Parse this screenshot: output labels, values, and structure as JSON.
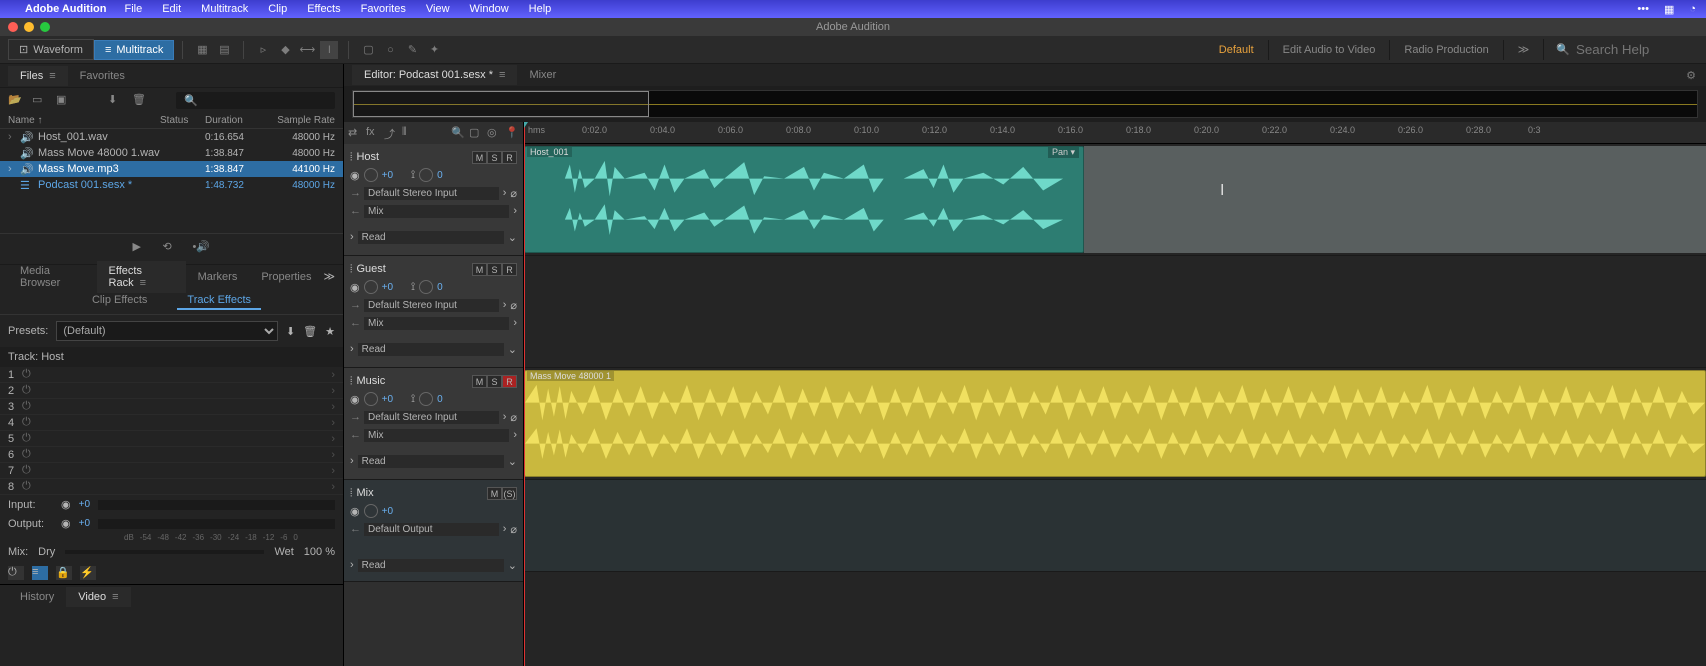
{
  "app": {
    "name": "Adobe Audition",
    "title": "Adobe Audition"
  },
  "menu": [
    "File",
    "Edit",
    "Multitrack",
    "Clip",
    "Effects",
    "Favorites",
    "View",
    "Window",
    "Help"
  ],
  "modes": {
    "waveform": "Waveform",
    "multitrack": "Multitrack"
  },
  "workspaces": {
    "default": "Default",
    "editAudio": "Edit Audio to Video",
    "radio": "Radio Production"
  },
  "search": {
    "placeholder": "Search Help"
  },
  "files": {
    "tab": "Files",
    "favorites": "Favorites",
    "cols": {
      "name": "Name ↑",
      "status": "Status",
      "duration": "Duration",
      "rate": "Sample Rate"
    },
    "rows": [
      {
        "name": "Host_001.wav",
        "dur": "0:16.654",
        "rate": "48000 Hz"
      },
      {
        "name": "Mass Move 48000 1.wav",
        "dur": "1:38.847",
        "rate": "48000 Hz"
      },
      {
        "name": "Mass Move.mp3",
        "dur": "1:38.847",
        "rate": "44100 Hz"
      },
      {
        "name": "Podcast 001.sesx *",
        "dur": "1:48.732",
        "rate": "48000 Hz"
      }
    ]
  },
  "bottomTabs": [
    "Media Browser",
    "Effects Rack",
    "Markers",
    "Properties"
  ],
  "subTabs": {
    "clip": "Clip Effects",
    "track": "Track Effects"
  },
  "presets": {
    "label": "Presets:",
    "value": "(Default)"
  },
  "trackLabel": "Track: Host",
  "io": {
    "input": "Input:",
    "output": "Output:",
    "mix": "Mix:",
    "dry": "Dry",
    "wet": "Wet",
    "pct": "100 %"
  },
  "dbScale": [
    "dB",
    "-54",
    "-48",
    "-42",
    "-36",
    "-30",
    "-24",
    "-18",
    "-12",
    "-6",
    "0"
  ],
  "historyTabs": {
    "history": "History",
    "video": "Video"
  },
  "editor": {
    "tab": "Editor: Podcast 001.sesx *",
    "mixer": "Mixer"
  },
  "ruler": {
    "unit": "hms",
    "ticks": [
      "0:02.0",
      "0:04.0",
      "0:06.0",
      "0:08.0",
      "0:10.0",
      "0:12.0",
      "0:14.0",
      "0:16.0",
      "0:18.0",
      "0:20.0",
      "0:22.0",
      "0:24.0",
      "0:26.0",
      "0:28.0",
      "0:3"
    ]
  },
  "tracks": [
    {
      "name": "Host",
      "color": "#2e8a7e",
      "vol": "+0",
      "pan": "0",
      "input": "Default Stereo Input",
      "mix": "Mix",
      "read": "Read",
      "msr": [
        "M",
        "S",
        "R"
      ]
    },
    {
      "name": "Guest",
      "color": "#5a3a8a",
      "vol": "+0",
      "pan": "0",
      "input": "Default Stereo Input",
      "mix": "Mix",
      "read": "Read",
      "msr": [
        "M",
        "S",
        "R"
      ]
    },
    {
      "name": "Music",
      "color": "#b89a2e",
      "vol": "+0",
      "pan": "0",
      "input": "Default Stereo Input",
      "mix": "Mix",
      "read": "Read",
      "msr": [
        "M",
        "S",
        "R"
      ]
    },
    {
      "name": "Mix",
      "color": "#3a6a7e",
      "vol": "+0",
      "output": "Default Output",
      "read": "Read",
      "msr": [
        "M",
        "(S)"
      ],
      "isMix": true
    }
  ],
  "clips": {
    "host": {
      "label": "Host_001",
      "pan": "Pan ▾"
    },
    "music": {
      "label": "Mass Move 48000 1"
    }
  }
}
